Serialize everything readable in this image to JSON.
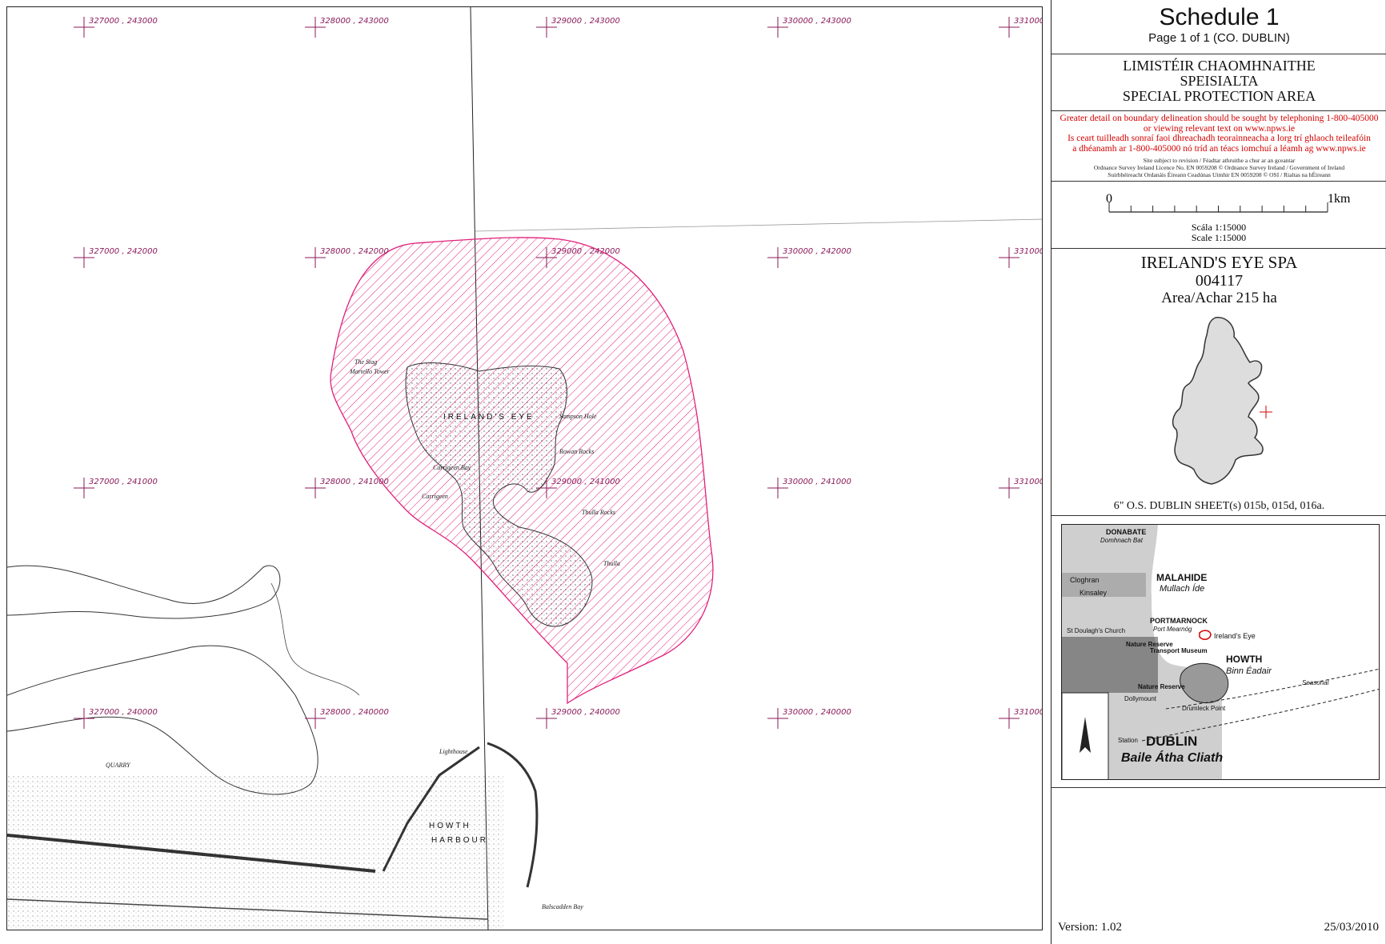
{
  "schedule": {
    "title": "Schedule 1",
    "page": "Page 1 of 1 (CO. DUBLIN)"
  },
  "designation": {
    "line1": "LIMISTÉIR CHAOMHNAITHE",
    "line2": "SPEISIALTA",
    "line3": "SPECIAL PROTECTION AREA"
  },
  "notice": {
    "red_line1": "Greater detail on boundary delineation should be sought by telephoning 1-800-405000",
    "red_line2": "or viewing relevant text on www.npws.ie",
    "red_line3": "Is ceart tuilleadh sonraí faoi dhreachadh teorainneacha a lorg trí ghlaoch teileafóin",
    "red_line4": "a dhéanamh ar 1-800-405000 nó tríd an téacs iomchuí a léamh ag www.npws.ie",
    "small_line1": "Site subject to revision / Féadtar athruithe a chur ar an gceantar",
    "small_line2": "Ordnance Survey Ireland Licence No. EN 0059208 © Ordnance Survey Ireland / Government of Ireland",
    "small_line3": "Suirbhéireacht Ordanáis Éireann Ceadúnas Uimhir EN 0059208 © OSI / Rialtas na hÉireann"
  },
  "scale": {
    "zero": "0",
    "end": "1km",
    "irish": "Scála 1:15000",
    "english": "Scale 1:15000"
  },
  "site": {
    "name": "IRELAND'S EYE SPA",
    "code": "004117",
    "area": "Area/Achar 215 ha",
    "sheets": "6\" O.S.  DUBLIN  SHEET(s) 015b, 015d, 016a."
  },
  "grid_labels": {
    "r1c1": "327000 , 243000",
    "r1c2": "328000 , 243000",
    "r1c3": "329000 , 243000",
    "r1c4": "330000 , 243000",
    "r1c5": "331000 ,",
    "r2c1": "327000 , 242000",
    "r2c2": "328000 , 242000",
    "r2c3": "329000 , 242000",
    "r2c4": "330000 , 242000",
    "r2c5": "331000 ,",
    "r3c1": "327000 , 241000",
    "r3c2": "328000 , 241000",
    "r3c3": "329000 , 241000",
    "r3c4": "330000 , 241000",
    "r3c5": "331000 ,",
    "r4c1": "327000 , 240000",
    "r4c2": "328000 , 240000",
    "r4c3": "329000 , 240000",
    "r4c4": "330000 , 240000",
    "r4c5": "331000 ,"
  },
  "map_labels": {
    "ireland_eye": "IRELAND'S EYE",
    "martello": "Martello Tower",
    "the_stag": "The Stag",
    "carrigeen_bay": "Carrigeen Bay",
    "carrigeen": "Carrigeen",
    "thulla_rocks": "Thulla Rocks",
    "thulla": "Thulla",
    "rowan_rocks": "Rowan Rocks",
    "sampsons_hole": "Sampson Hole",
    "howth": "HOWTH",
    "harbour": "HARBOUR",
    "quarry": "QUARRY",
    "balscadden": "Balscadden Bay",
    "lighthouse": "Lighthouse"
  },
  "inset": {
    "donabate": "DONABATE",
    "donabate_ir": "Domhnach Bat",
    "malahide": "MALAHIDE",
    "malahide_ir": "Mullach Íde",
    "cloghran": "Cloghran",
    "kinsaley": "Kinsaley",
    "st_doulaghs": "St Doulagh's Church",
    "portmarnock": "PORTMARNOCK",
    "portmarnock_ir": "Port Mearnóg",
    "nature_reserve": "Nature Reserve",
    "transport_museum": "Transport Museum",
    "irelands_eye": "Ireland's Eye",
    "howth": "HOWTH",
    "howth_ir": "Binn Éadair",
    "nature_reserve2": "Nature Reserve",
    "dollymount": "Dollymount",
    "drumleck": "Drumleck Point",
    "station": "Station",
    "dublin": "DUBLIN",
    "dublin_ir": "Baile Átha Cliath",
    "seasonal": "Seasonal"
  },
  "footer": {
    "version": "Version: 1.02",
    "date": "25/03/2010"
  },
  "colors": {
    "spa_boundary": "#e0207a",
    "grid_marker": "#8a1a5a",
    "notice_red": "#d40000"
  }
}
